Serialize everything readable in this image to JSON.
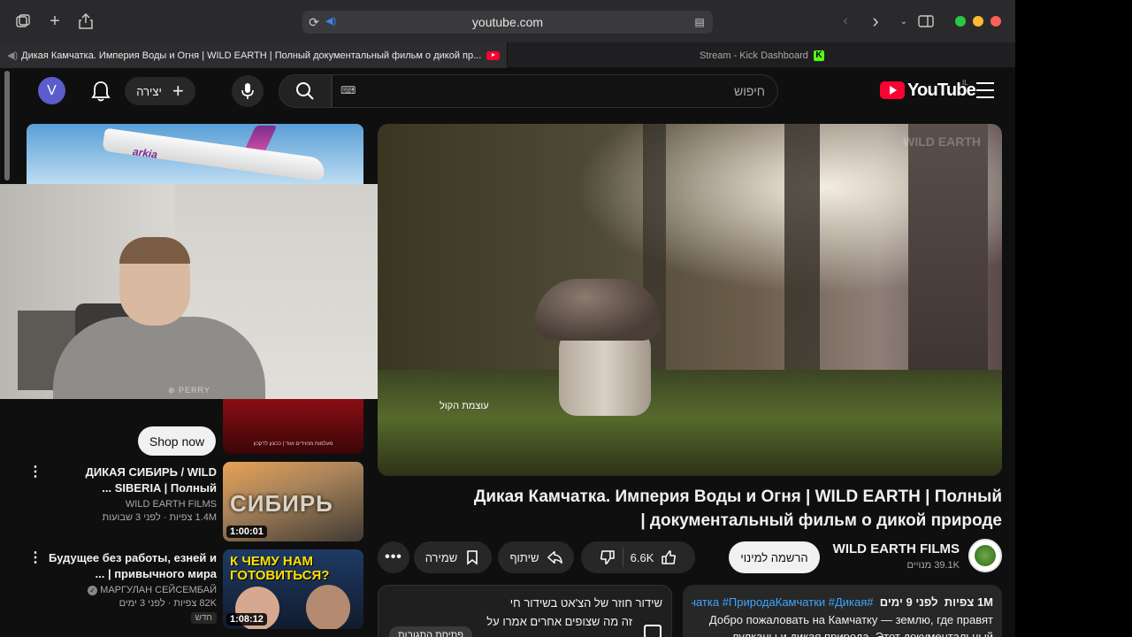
{
  "browser": {
    "address": "youtube.com",
    "tabs": [
      {
        "label": "Дикая Камчатка. Империя Воды и Огня | WILD EARTH | Полный документальный фильм о дикой пр...",
        "active": true
      },
      {
        "label": "Stream - Kick Dashboard",
        "active": false
      }
    ],
    "traffic_lights": {
      "green": "#2ac840",
      "yellow": "#febc2e",
      "red": "#ff5f57"
    }
  },
  "header": {
    "avatar_letter": "V",
    "create_label": "יצירה",
    "search_placeholder": "חיפוש",
    "logo_text": "YouTube",
    "country": "IL",
    "accent": "#ff0033"
  },
  "sidebar": {
    "ad_brand": "arkia",
    "shop_now": "Shop now",
    "red_thumb_caption": "מעלמות מהוידים ועוד | ככונון לדקכון",
    "videos": [
      {
        "title": "ДИКАЯ СИБИРЬ / WILD SIBERIA | Полный ...",
        "channel": "WILD EARTH FILMS",
        "meta": "1.4M צפיות · לפני 3 שבועות",
        "duration": "1:00:01",
        "thumb_word": "СИБИРЬ",
        "badge": ""
      },
      {
        "title": "Будущее без работы, езней и привычного мира | ...",
        "channel": "МАРГУЛАН СЕЙСЕМБАЙ",
        "meta": "82K צפיות · לפני 3 ימים",
        "duration": "1:08:12",
        "thumb_word": "К ЧЕМУ НАМ ГОТОВИТЬСЯ?",
        "badge": "חדש"
      }
    ]
  },
  "video": {
    "watermark": "WILD EARTH",
    "caption": "עוצמת הקול",
    "title": "Дикая Камчатка. Империя Воды и Огня | WILD EARTH | Полный документальный фильм о дикой природе |",
    "actions": {
      "save": "שמירה",
      "share": "שיתוף",
      "likes": "6.6K",
      "more": "•••"
    },
    "channel": {
      "name": "WILD EARTH FILMS",
      "subscribers": "39.1K מנויים",
      "subscribe_label": "הרשמה למינוי"
    },
    "description": {
      "views": "1M צפיות",
      "age": "לפני 9 ימים",
      "tags": "#Камчатка #ПриродаКамчатки #Дикая",
      "text": "Добро пожаловать на Камчатку — землю, где правят вулканы и дикая природа. Этот документальный..."
    },
    "chat": {
      "line1": "שידור חוזר של הצ'אט בשידור חי",
      "line2": "זה מה שצופים אחרים אמרו על",
      "open_label": "פתיחת התגובות"
    }
  }
}
